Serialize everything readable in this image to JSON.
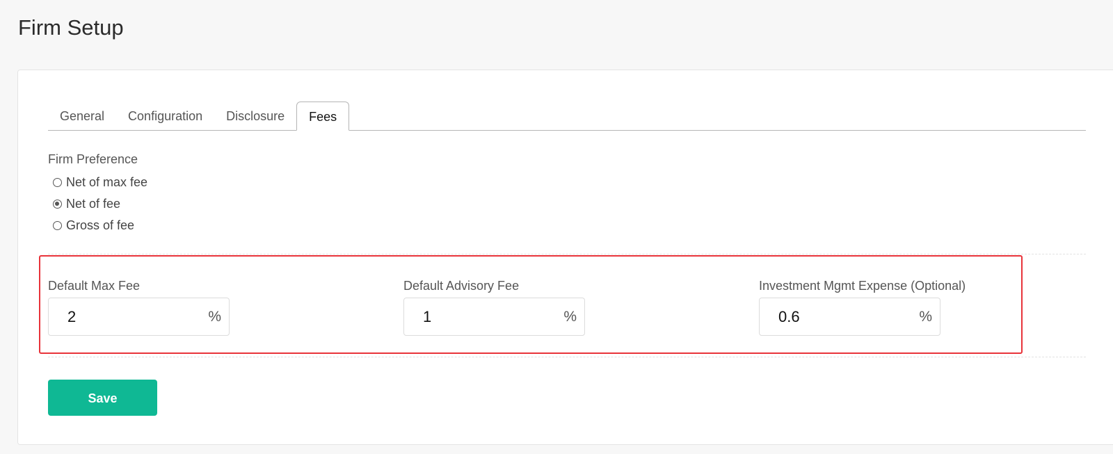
{
  "page": {
    "title": "Firm Setup"
  },
  "tabs": [
    {
      "label": "General",
      "active": false
    },
    {
      "label": "Configuration",
      "active": false
    },
    {
      "label": "Disclosure",
      "active": false
    },
    {
      "label": "Fees",
      "active": true
    }
  ],
  "firm_preference": {
    "label": "Firm Preference",
    "options": [
      {
        "label": "Net of max fee",
        "checked": false
      },
      {
        "label": "Net of fee",
        "checked": true
      },
      {
        "label": "Gross of fee",
        "checked": false
      }
    ]
  },
  "fees": {
    "default_max_fee": {
      "label": "Default Max Fee",
      "value": "2",
      "unit": "%"
    },
    "default_advisory_fee": {
      "label": "Default Advisory Fee",
      "value": "1",
      "unit": "%"
    },
    "investment_mgmt_expense": {
      "label": "Investment Mgmt Expense (Optional)",
      "value": "0.6",
      "unit": "%"
    }
  },
  "actions": {
    "save_label": "Save"
  },
  "colors": {
    "accent": "#0fb894",
    "highlight": "#e8333a"
  }
}
